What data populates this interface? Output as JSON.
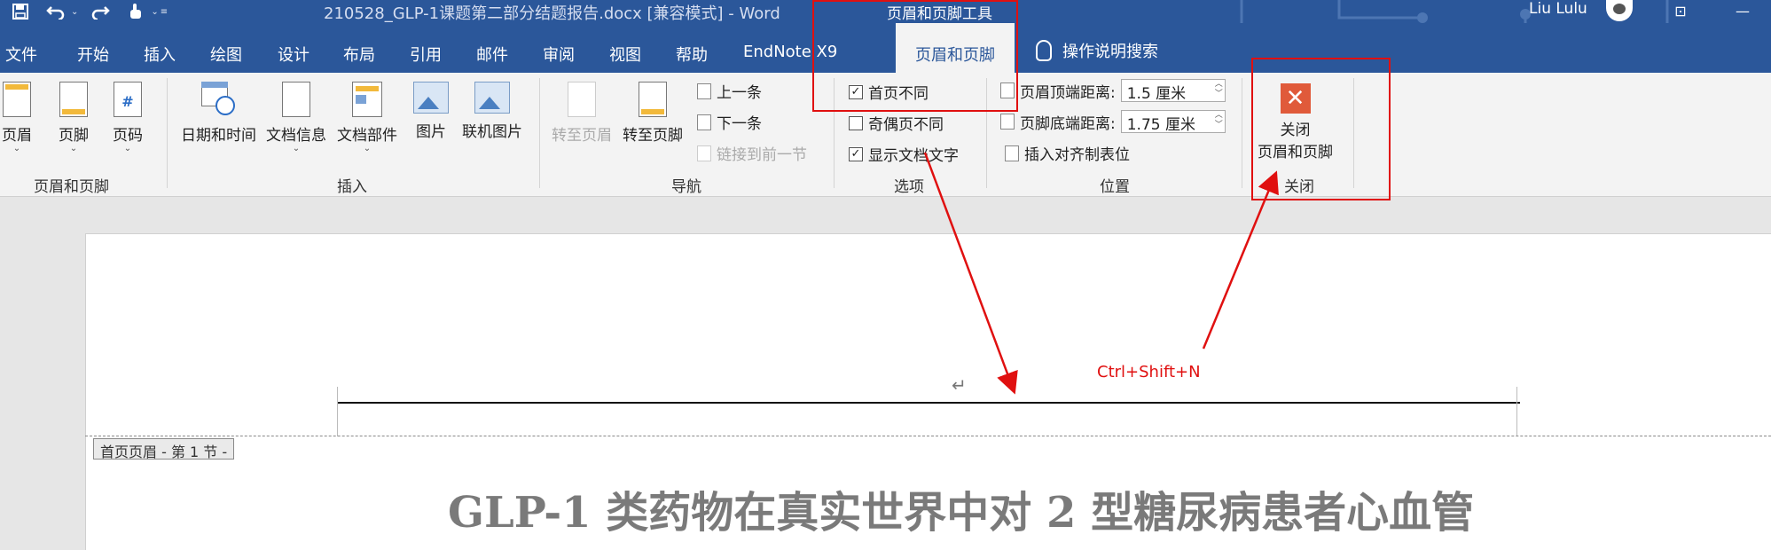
{
  "titlebar": {
    "doc_title": "210528_GLP-1课题第二部分结题报告.docx [兼容模式]  -  Word",
    "contextual_title": "页眉和页脚工具",
    "user_name": "Liu Lulu"
  },
  "tabs": {
    "file": "文件",
    "home": "开始",
    "insert": "插入",
    "draw": "绘图",
    "design": "设计",
    "layout": "布局",
    "references": "引用",
    "mailings": "邮件",
    "review": "审阅",
    "view": "视图",
    "help": "帮助",
    "endnote": "EndNote X9",
    "header_footer": "页眉和页脚",
    "tell_me": "操作说明搜索"
  },
  "ribbon": {
    "hf_group": {
      "header": "页眉",
      "footer": "页脚",
      "page_number": "页码",
      "label": "页眉和页脚"
    },
    "insert_group": {
      "date_time": "日期和时间",
      "doc_info": "文档信息",
      "doc_parts": "文档部件",
      "picture": "图片",
      "online_picture": "联机图片",
      "label": "插入"
    },
    "nav_group": {
      "goto_header": "转至页眉",
      "goto_footer": "转至页脚",
      "previous": "上一条",
      "next": "下一条",
      "link_previous": "链接到前一节",
      "label": "导航"
    },
    "options_group": {
      "different_first": "首页不同",
      "different_odd_even": "奇偶页不同",
      "show_doc_text": "显示文档文字",
      "label": "选项",
      "different_first_checked": true,
      "different_odd_even_checked": false,
      "show_doc_text_checked": true
    },
    "position_group": {
      "header_from_top_label": "页眉顶端距离:",
      "header_from_top_value": "1.5 厘米",
      "footer_from_bottom_label": "页脚底端距离:",
      "footer_from_bottom_value": "1.75 厘米",
      "insert_align_tab": "插入对齐制表位",
      "label": "位置"
    },
    "close_group": {
      "close_line1": "关闭",
      "close_line2": "页眉和页脚",
      "label": "关闭"
    }
  },
  "document": {
    "header_tag": "首页页眉 - 第 1 节 -",
    "heading": "GLP-1 类药物在真实世界中对 2 型糖尿病患者心血管",
    "annotation_shortcut": "Ctrl+Shift+N"
  },
  "colors": {
    "brand": "#2b579a",
    "annotation": "#e01010",
    "close_button": "#e05a3a"
  }
}
